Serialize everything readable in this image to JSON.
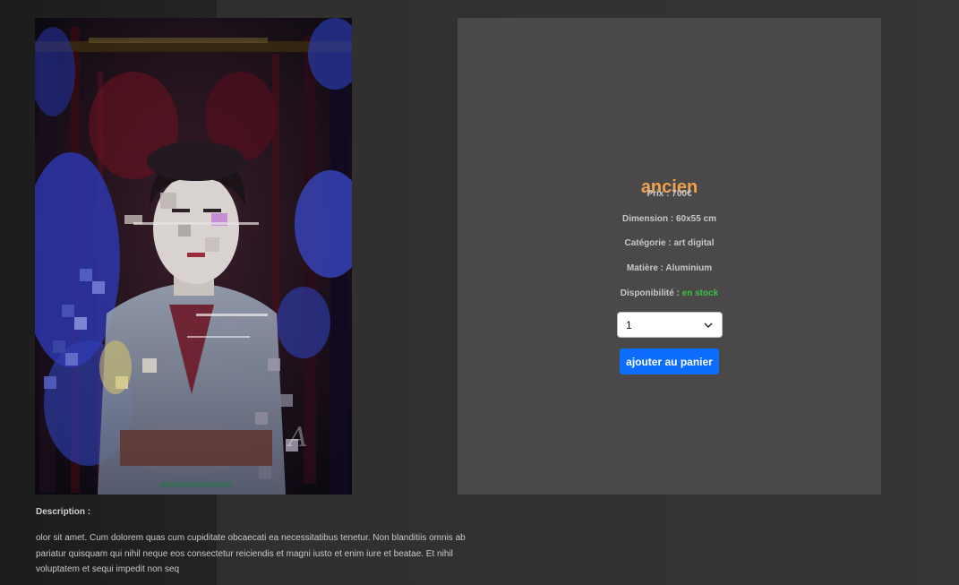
{
  "product": {
    "title": "ancien",
    "price": "Prix : 700€",
    "dimension": "Dimension : 60x55 cm",
    "category": "Catégorie : art digital",
    "material": "Matière : Aluminium",
    "availability_label": "Disponibilité :",
    "availability_value": "en stock",
    "quantity": "1",
    "add_to_cart_label": "ajouter au panier"
  },
  "artwork": {
    "description": "glitch digital portrait artwork",
    "watermark_letter": "A"
  },
  "description": {
    "heading": "Description :",
    "text": "olor sit amet. Cum dolorem quas cum cupiditate obcaecati ea necessitatibus tenetur. Non blanditiis omnis ab pariatur quisquam qui nihil neque eos consectetur reiciendis et magni iusto et enim iure et beatae. Et nihil voluptatem et sequi impedit non seq"
  },
  "colors": {
    "accent_title": "#f2a24c",
    "button": "#0d6efd",
    "in_stock": "#3ec142",
    "card_bg": "#4a4849"
  }
}
